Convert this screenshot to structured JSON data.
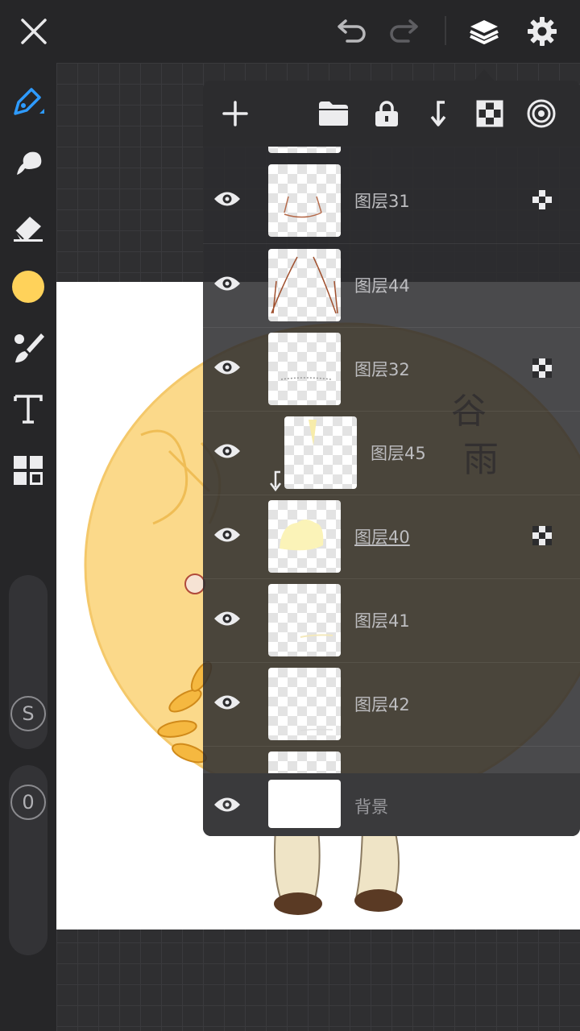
{
  "topbar": {
    "close_icon": "close-icon",
    "undo_icon": "undo-icon",
    "redo_icon": "redo-icon",
    "layers_icon": "layers-icon",
    "settings_icon": "gear-icon"
  },
  "toolbar": {
    "tools": [
      "pen-tool-icon",
      "smudge-tool-icon",
      "eraser-icon",
      "color-swatch",
      "brush-settings-icon",
      "text-tool-icon",
      "grid-tools-icon"
    ],
    "current_color": "#FFD25A",
    "accent_color": "#2E9BFF",
    "size_label": "S",
    "opacity_label": "0"
  },
  "layer_panel": {
    "header_icons": [
      "add-layer-icon",
      "folder-icon",
      "lock-icon",
      "clip-icon",
      "alpha-lock-icon",
      "blend-icon"
    ],
    "layers": [
      {
        "name": "图层31",
        "alpha_lock": true,
        "clipped": false
      },
      {
        "name": "图层44",
        "alpha_lock": false,
        "clipped": false
      },
      {
        "name": "图层32",
        "alpha_lock": true,
        "clipped": false
      },
      {
        "name": "图层45",
        "alpha_lock": false,
        "clipped": true
      },
      {
        "name": "图层40",
        "alpha_lock": true,
        "clipped": false,
        "selected": true
      },
      {
        "name": "图层41",
        "alpha_lock": false,
        "clipped": false
      },
      {
        "name": "图层42",
        "alpha_lock": false,
        "clipped": false
      }
    ],
    "background_label": "背景"
  },
  "canvas": {
    "watermark_chars": [
      "谷",
      "雨"
    ]
  }
}
